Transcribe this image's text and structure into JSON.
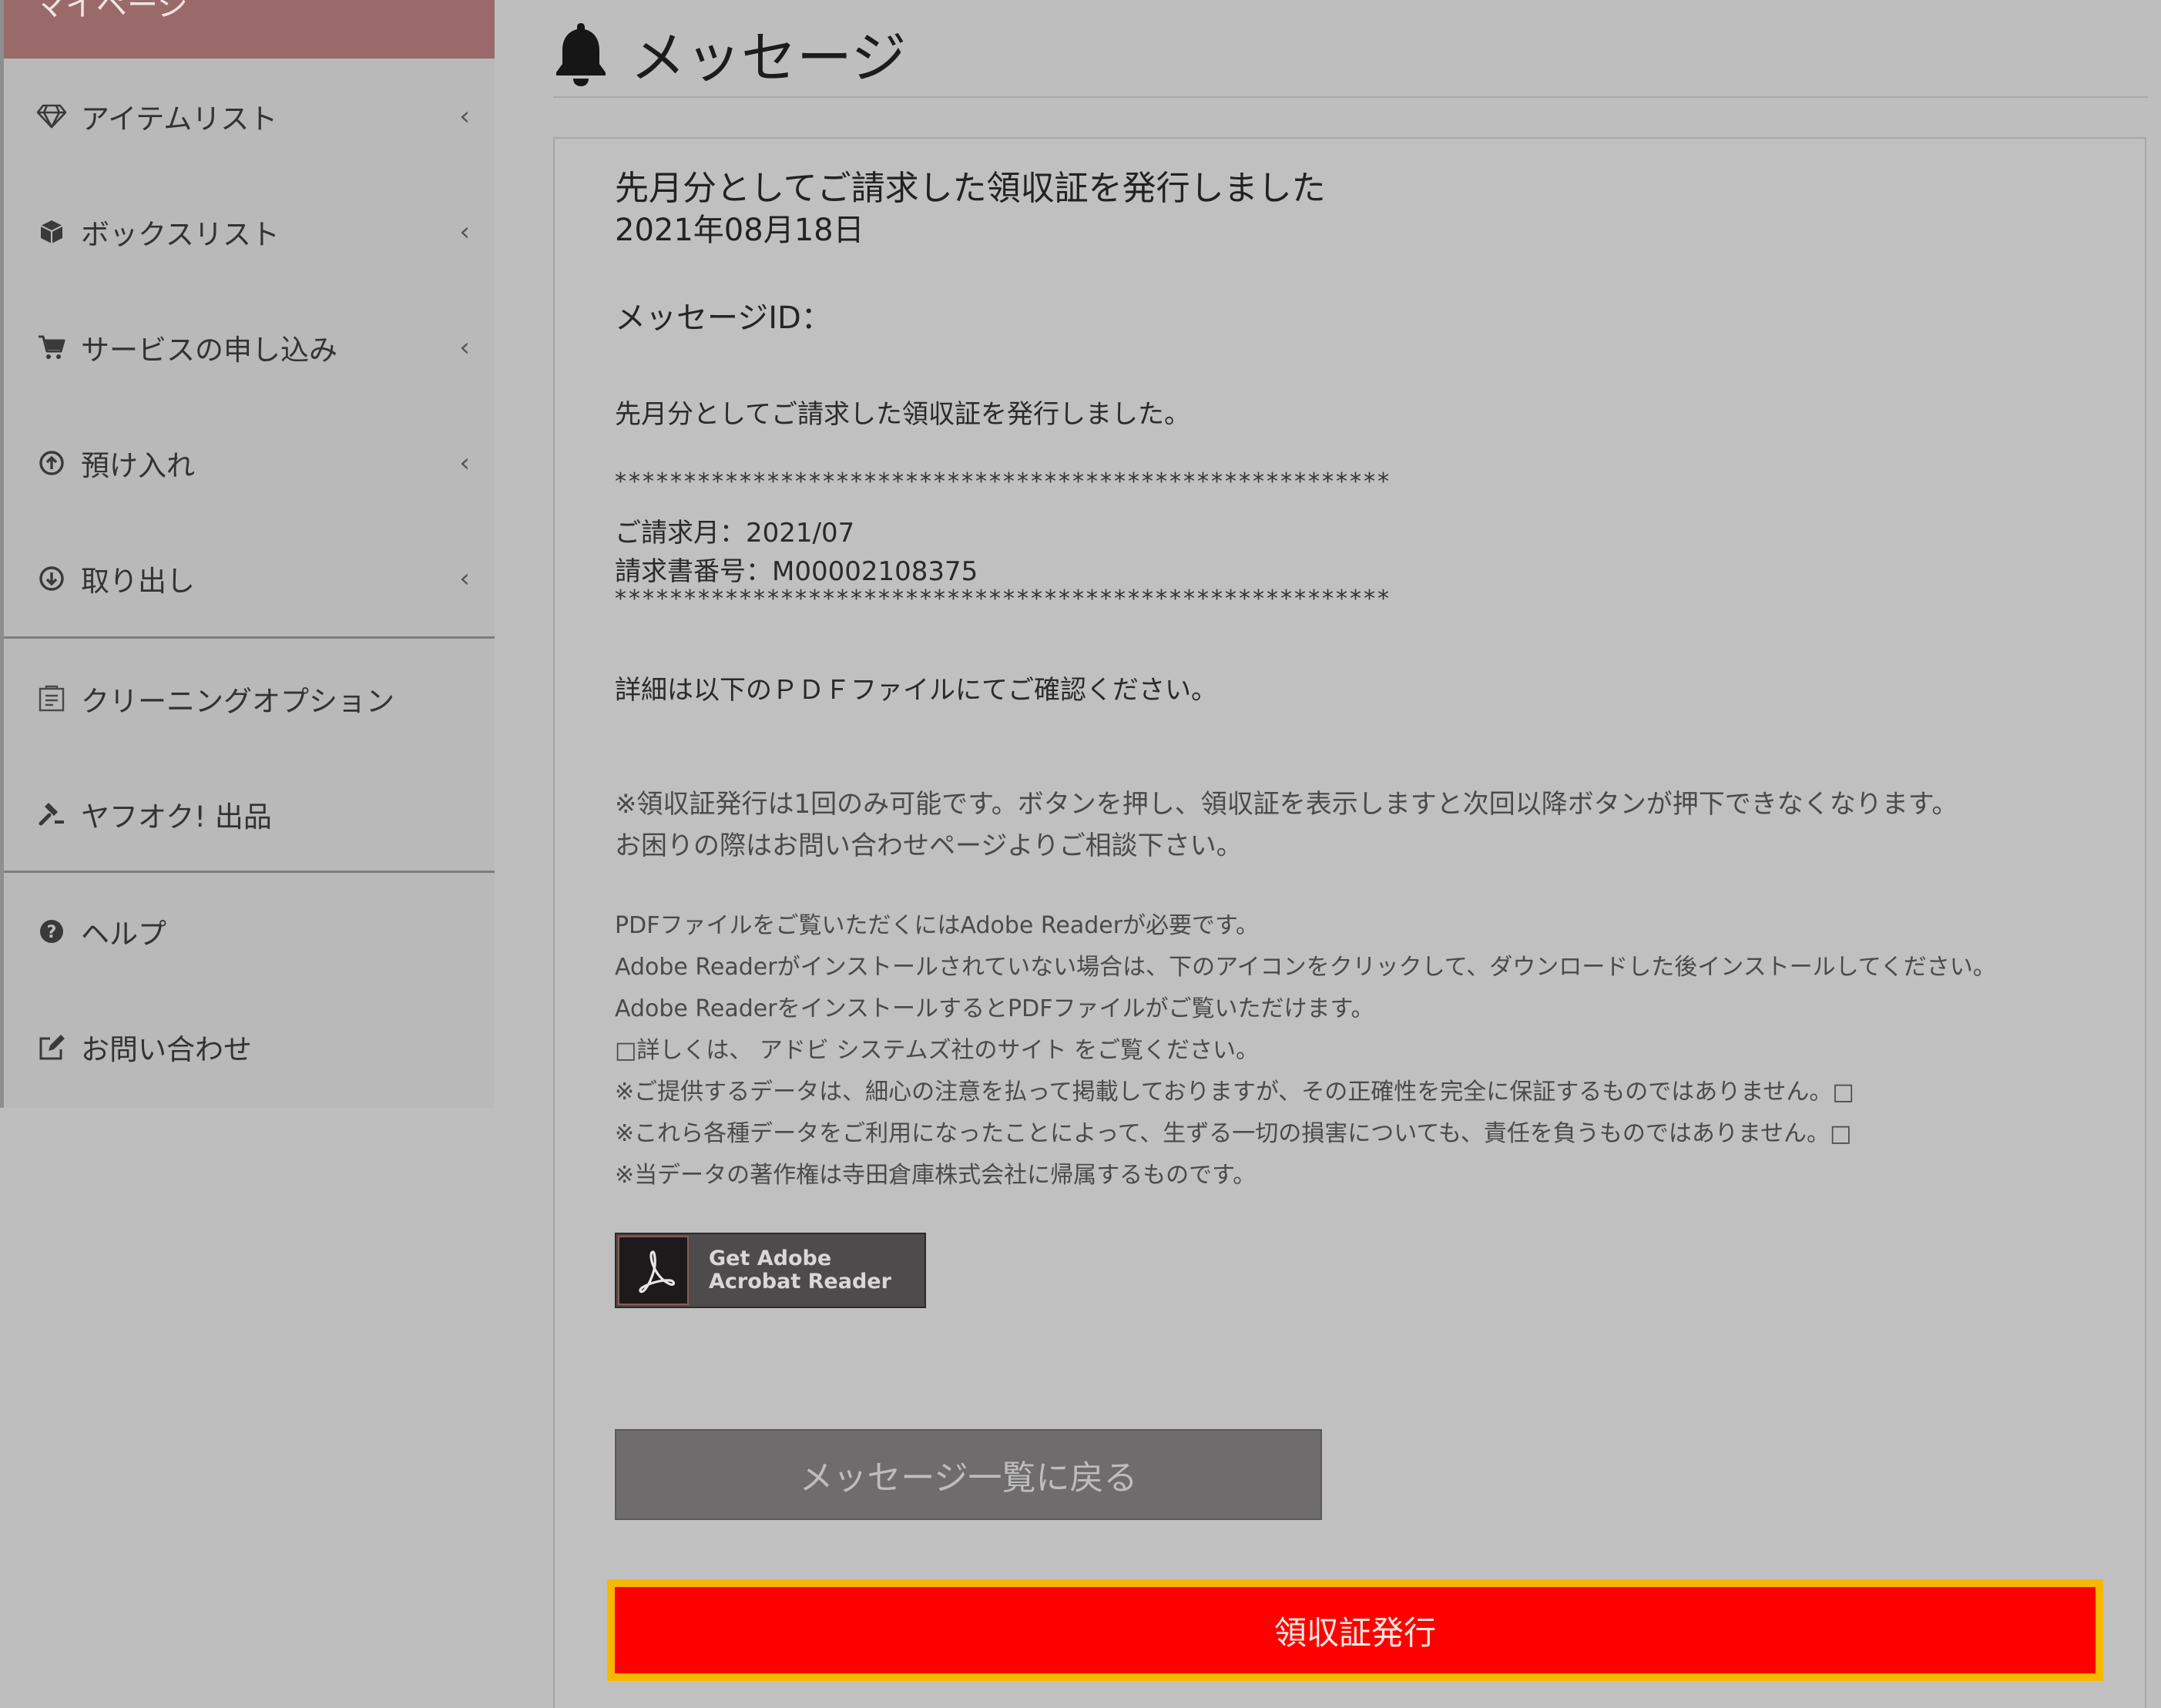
{
  "sidebar": {
    "top_label": "マイページ",
    "items": [
      {
        "label": "アイテムリスト",
        "icon": "diamond-icon",
        "chevron": "‹"
      },
      {
        "label": "ボックスリスト",
        "icon": "box-icon",
        "chevron": "‹"
      },
      {
        "label": "サービスの申し込み",
        "icon": "cart-icon",
        "chevron": "‹"
      },
      {
        "label": "預け入れ",
        "icon": "arrow-up-circle-icon",
        "chevron": "‹"
      },
      {
        "label": "取り出し",
        "icon": "arrow-down-circle-icon",
        "chevron": "‹"
      },
      {
        "label": "クリーニングオプション",
        "icon": "cleaning-icon"
      },
      {
        "label": "ヤフオク! 出品",
        "icon": "gavel-icon"
      },
      {
        "label": "ヘルプ",
        "icon": "question-circle-icon"
      },
      {
        "label": "お問い合わせ",
        "icon": "edit-icon"
      }
    ]
  },
  "header": {
    "title": "メッセージ",
    "icon": "bell-icon"
  },
  "message": {
    "title": "先月分としてご請求した領収証を発行しました",
    "date": "2021年08月18日",
    "id_label": "メッセージID：",
    "body_intro": "先月分としてご請求した領収証を発行しました。",
    "separator": "********************************************************",
    "billing_month": "ご請求月：2021/07",
    "invoice_number": "請求書番号：M00002108375",
    "details": "詳細は以下のＰＤＦファイルにてご確認ください。",
    "notice_lines": [
      "※領収証発行は1回のみ可能です。ボタンを押し、領収証を表示しますと次回以降ボタンが押下できなくなります。",
      "お困りの際はお問い合わせページよりご相談下さい。"
    ],
    "adobe_lines": [
      "PDFファイルをご覧いただくにはAdobe Readerが必要です。",
      "Adobe Readerがインストールされていない場合は、下のアイコンをクリックして、ダウンロードした後インストールしてください。",
      "Adobe ReaderをインストールするとPDFファイルがご覧いただけます。",
      "□詳しくは、 アドビ システムズ社のサイト をご覧ください。",
      "※ご提供するデータは、細心の注意を払って掲載しておりますが、その正確性を完全に保証するものではありません。□",
      "※これら各種データをご利用になったことによって、生ずる一切の損害についても、責任を負うものではありません。□",
      "※当データの著作権は寺田倉庫株式会社に帰属するものです。"
    ],
    "adobe_badge": {
      "line1": "Get Adobe",
      "line2": "Acrobat Reader",
      "icon": "acrobat-logo-icon"
    }
  },
  "buttons": {
    "back": "メッセージ一覧に戻る",
    "receipt": "領収証発行"
  },
  "colors": {
    "receipt_button_bg": "#ff0000",
    "receipt_button_border": "#f6b800",
    "back_button_bg": "#6e6c6d",
    "sidebar_top_bg": "#9a6a6a"
  }
}
